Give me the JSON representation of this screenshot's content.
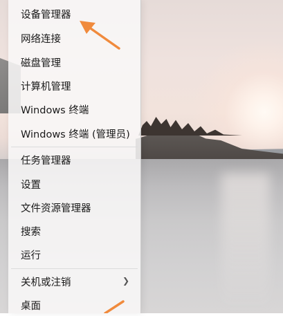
{
  "menu": {
    "items": [
      {
        "label": "设备管理器",
        "name": "menu-item-device-manager"
      },
      {
        "label": "网络连接",
        "name": "menu-item-network-connections"
      },
      {
        "label": "磁盘管理",
        "name": "menu-item-disk-management"
      },
      {
        "label": "计算机管理",
        "name": "menu-item-computer-management"
      },
      {
        "label": "Windows 终端",
        "name": "menu-item-windows-terminal"
      },
      {
        "label": "Windows 终端 (管理员)",
        "name": "menu-item-windows-terminal-admin"
      },
      {
        "label": "任务管理器",
        "name": "menu-item-task-manager"
      },
      {
        "label": "设置",
        "name": "menu-item-settings"
      },
      {
        "label": "文件资源管理器",
        "name": "menu-item-file-explorer"
      },
      {
        "label": "搜索",
        "name": "menu-item-search"
      },
      {
        "label": "运行",
        "name": "menu-item-run"
      },
      {
        "label": "关机或注销",
        "name": "menu-item-shutdown-signout",
        "submenu": true,
        "icon": "chevron-right-icon"
      },
      {
        "label": "桌面",
        "name": "menu-item-desktop"
      }
    ]
  },
  "annotation": {
    "arrow_color": "#f08a3c"
  }
}
